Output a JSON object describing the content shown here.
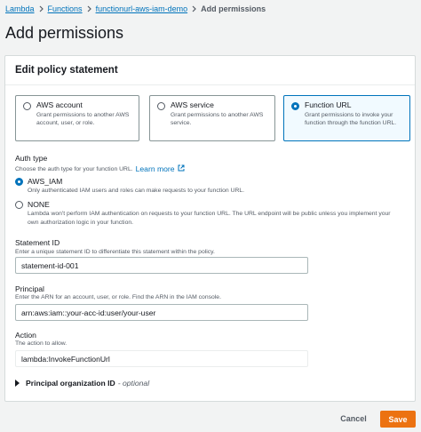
{
  "breadcrumb": {
    "items": [
      "Lambda",
      "Functions",
      "functionurl-aws-iam-demo"
    ],
    "current": "Add permissions"
  },
  "page": {
    "title": "Add permissions"
  },
  "panel": {
    "header": "Edit policy statement",
    "tiles": [
      {
        "title": "AWS account",
        "description": "Grant permissions to another AWS account, user, or role.",
        "selected": false
      },
      {
        "title": "AWS service",
        "description": "Grant permissions to another AWS service.",
        "selected": false
      },
      {
        "title": "Function URL",
        "description": "Grant permissions to invoke your function through the function URL.",
        "selected": true
      }
    ],
    "auth_type": {
      "label": "Auth type",
      "description": "Choose the auth type for your function URL.",
      "learn_more": "Learn more",
      "options": [
        {
          "label": "AWS_IAM",
          "description": "Only authenticated IAM users and roles can make requests to your function URL.",
          "selected": true
        },
        {
          "label": "NONE",
          "description": "Lambda won't perform IAM authentication on requests to your function URL. The URL endpoint will be public unless you implement your own authorization logic in your function.",
          "selected": false
        }
      ]
    },
    "statement_id": {
      "label": "Statement ID",
      "description": "Enter a unique statement ID to differentiate this statement within the policy.",
      "value": "statement-id-001"
    },
    "principal": {
      "label": "Principal",
      "description": "Enter the ARN for an account, user, or role. Find the ARN in the IAM console.",
      "value": "arn:aws:iam::your-acc-id:user/your-user"
    },
    "action": {
      "label": "Action",
      "description": "The action to allow.",
      "value": "lambda:InvokeFunctionUrl"
    },
    "principal_org": {
      "label": "Principal organization ID",
      "optional": "- optional"
    }
  },
  "footer": {
    "cancel": "Cancel",
    "save": "Save"
  },
  "colors": {
    "link": "#0073bb",
    "primary": "#ec7211",
    "selected_bg": "#f1faff"
  }
}
